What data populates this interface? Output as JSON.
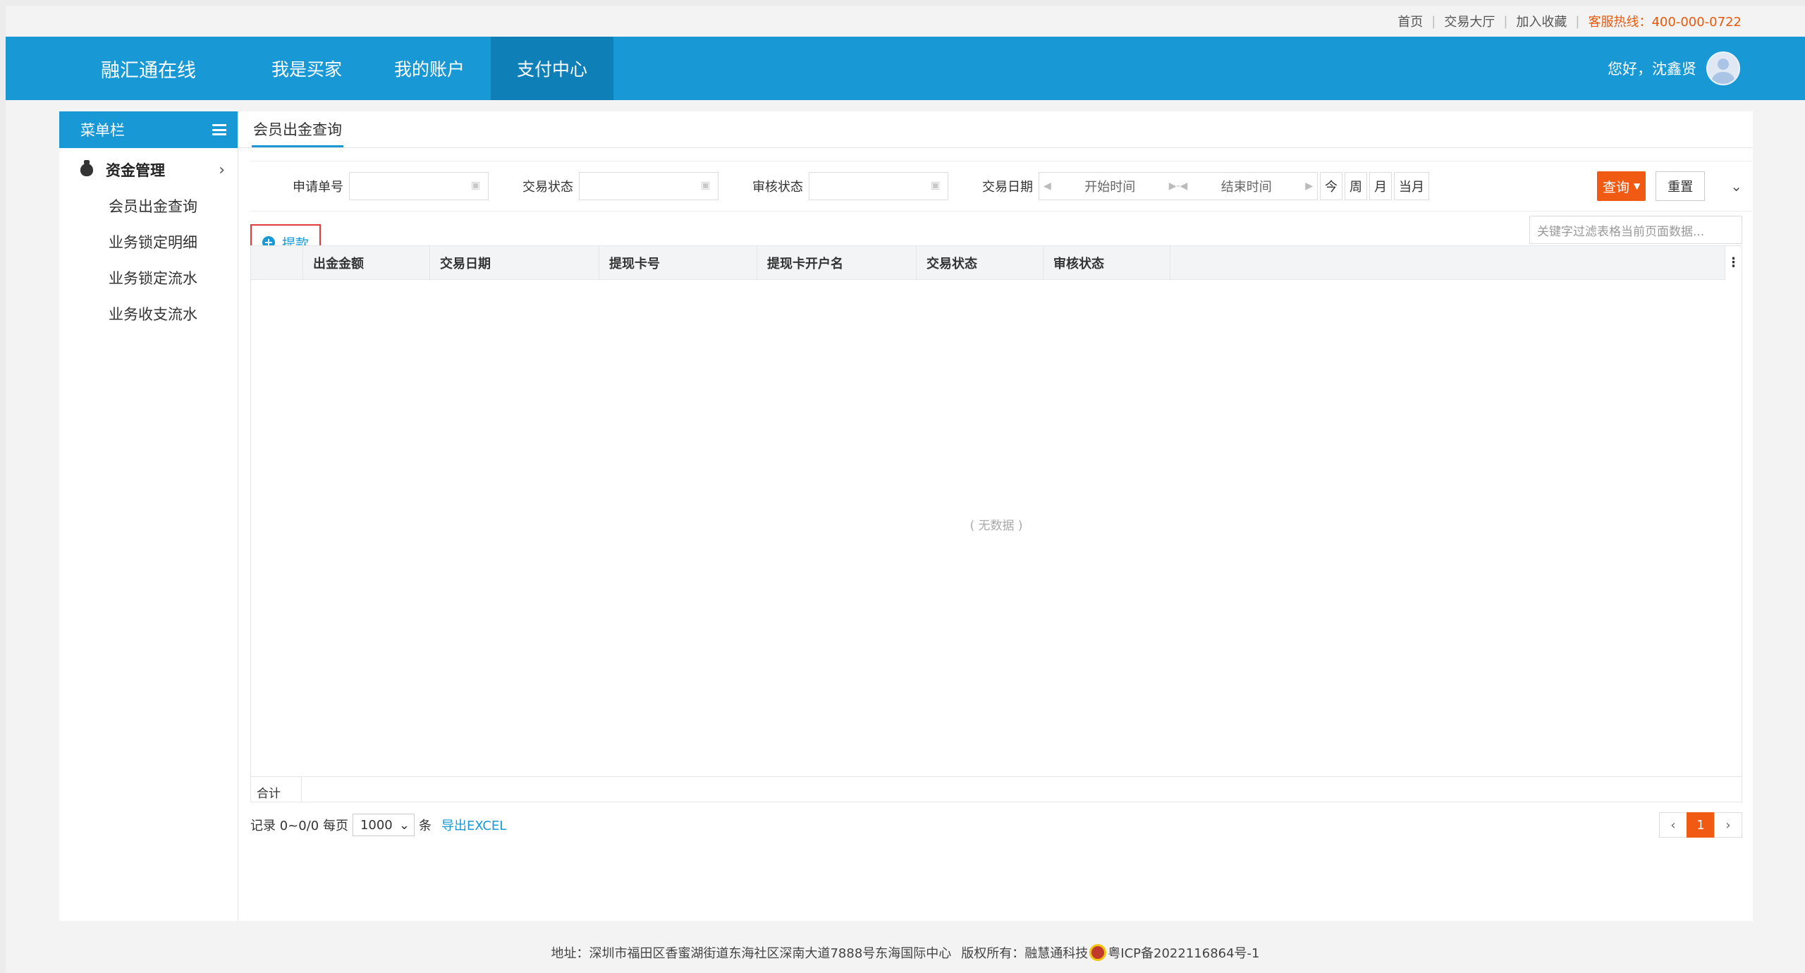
{
  "top_links": {
    "home": "首页",
    "trade_hall": "交易大厅",
    "favorite": "加入收藏",
    "hotline": "客服热线：400-000-0722"
  },
  "header": {
    "brand": "融汇通在线",
    "nav": [
      "我是买家",
      "我的账户",
      "支付中心"
    ],
    "active_nav": "支付中心",
    "greeting": "您好，沈鑫贤"
  },
  "sidebar": {
    "title": "菜单栏",
    "group": "资金管理",
    "items": [
      "会员出金查询",
      "业务锁定明细",
      "业务锁定流水",
      "业务收支流水"
    ]
  },
  "tab": "会员出金查询",
  "filter": {
    "apply_no_label": "申请单号",
    "trade_status_label": "交易状态",
    "audit_status_label": "审核状态",
    "trade_date_label": "交易日期",
    "start_placeholder": "开始时间",
    "end_placeholder": "结束时间",
    "quick": [
      "今",
      "周",
      "月",
      "当月"
    ],
    "query": "查询",
    "reset": "重置"
  },
  "toolbar": {
    "withdraw": "提款",
    "keyword_placeholder": "关键字过滤表格当前页面数据..."
  },
  "table": {
    "columns": [
      "出金金额",
      "交易日期",
      "提现卡号",
      "提现卡开户名",
      "交易状态",
      "审核状态"
    ],
    "empty": "( 无数据 )",
    "sum_label": "合计"
  },
  "pager": {
    "records": "记录 0~0/0 每页",
    "page_size": "1000",
    "unit": "条",
    "export": "导出EXCEL",
    "current_page": "1"
  },
  "footer": {
    "address": "地址：深圳市福田区香蜜湖街道东海社区深南大道7888号东海国际中心",
    "copyright": "版权所有：融慧通科技",
    "icp": "粤ICP备2022116864号-1"
  },
  "colors": {
    "primary": "#1899d6",
    "accent": "#f15a13"
  }
}
